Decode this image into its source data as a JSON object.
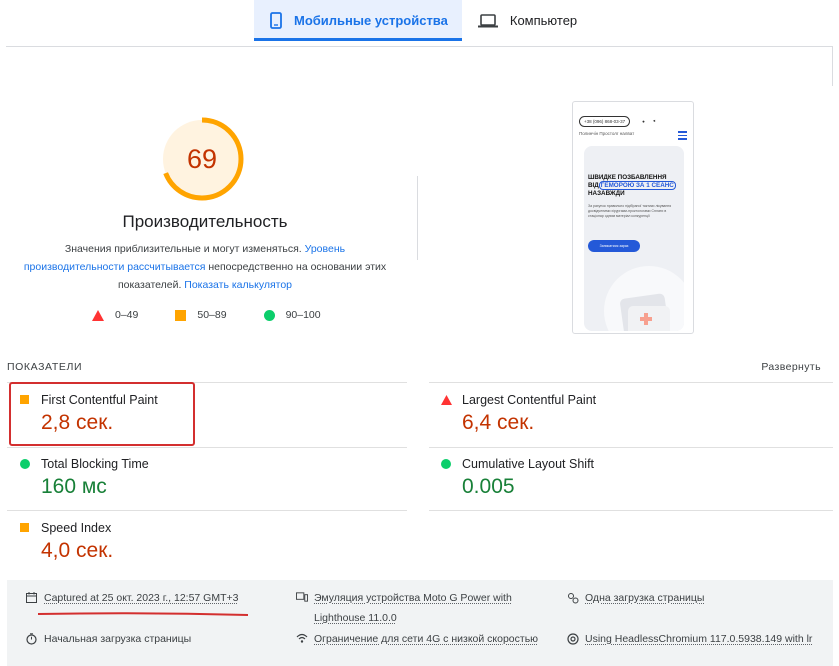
{
  "tabs": [
    {
      "label": "Мобильные устройства",
      "icon": "phone-icon",
      "active": true
    },
    {
      "label": "Компьютер",
      "icon": "laptop-icon",
      "active": false
    }
  ],
  "score": {
    "value": 69,
    "fraction": 0.69,
    "title": "Производительность",
    "desc_1": "Значения приблизительные и могут изменяться. ",
    "desc_link_1": "Уровень производительности рассчитывается",
    "desc_2": " непосредственно на основании этих показателей. ",
    "desc_link_2": "Показать калькулятор"
  },
  "legend": [
    {
      "range": "0–49",
      "icon": "red-triangle-icon"
    },
    {
      "range": "50–89",
      "icon": "orange-square-icon"
    },
    {
      "range": "90–100",
      "icon": "green-circle-icon"
    }
  ],
  "preview": {
    "phone_number": "+38 (096) 868-03-37",
    "subtitle": "Полинчін Простолг налват",
    "headline_1": "ШВИДКЕ ПОЗБАВЛЕННЯ",
    "headline_2_pre": "ВІД",
    "headline_2_hl": "ГЕМОРОЮ ЗА 1 СЕАНС",
    "headline_3": "НАЗАВЖДИ",
    "small_text": "За рахунок правильно підібраної тактики лікування досвідченими хірургами-проктологами Сплати в стаціонар одним матеріал конкуренції",
    "button": "Записатися зараз"
  },
  "metrics": {
    "header": "ПОКАЗАТЕЛИ",
    "expand": "Развернуть",
    "items": [
      {
        "name": "First Contentful Paint",
        "value": "2,8 сек.",
        "status": "average"
      },
      {
        "name": "Largest Contentful Paint",
        "value": "6,4 сек.",
        "status": "poor"
      },
      {
        "name": "Total Blocking Time",
        "value": "160 мс",
        "status": "good"
      },
      {
        "name": "Cumulative Layout Shift",
        "value": "0.005",
        "status": "good"
      },
      {
        "name": "Speed Index",
        "value": "4,0 сек.",
        "status": "average"
      }
    ]
  },
  "footer": {
    "captured": "Captured at 25 окт. 2023 г., 12:57 GMT+3",
    "emulation_1": "Эмуляция устройства Moto G Power with",
    "emulation_2": "Lighthouse 11.0.0",
    "single_load": "Одна загрузка страницы",
    "initial_load": "Начальная загрузка страницы",
    "throttling": "Ограничение для сети 4G с низкой скоростью",
    "browser": "Using HeadlessChromium 117.0.5938.149 with lr"
  },
  "colors": {
    "accent": "#1a73e8",
    "poor": "#c33300",
    "average": "#ffa400",
    "good": "#0cce6b",
    "highlight_box": "#d32f2f"
  }
}
